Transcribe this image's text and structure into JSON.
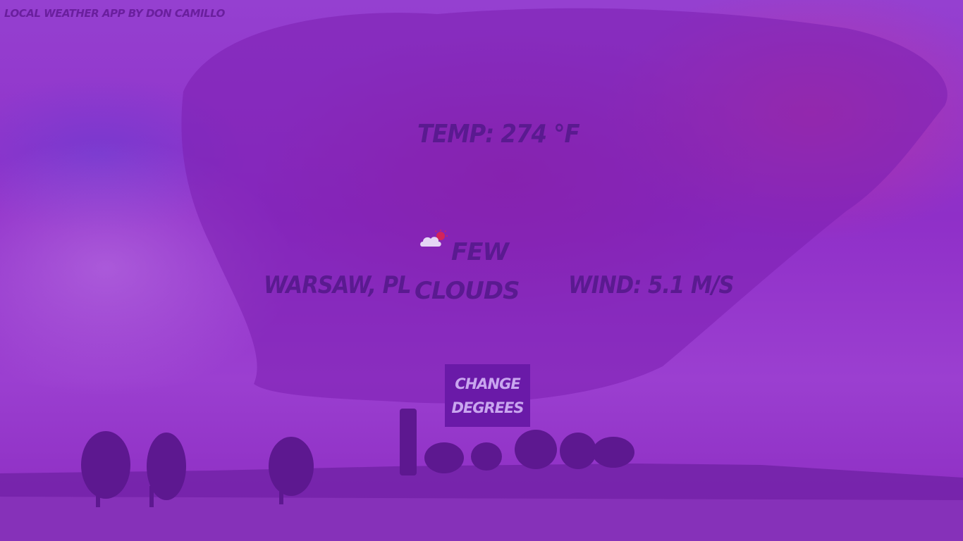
{
  "app": {
    "credit": "Local weather app by Don Camillo"
  },
  "weather": {
    "temperature": "Temp: 274 °F",
    "location": "Warsaw, PL",
    "condition_line1": "Few",
    "condition_line2": "Clouds",
    "condition_icon": "few-clouds-icon",
    "wind": "Wind: 5.1 m/s"
  },
  "controls": {
    "change_label": "Change Degrees"
  },
  "colors": {
    "background": "#8a2fc6",
    "text": "#5a1a90",
    "button_bg": "#6a1aa8",
    "button_text": "#c9a6ef"
  }
}
